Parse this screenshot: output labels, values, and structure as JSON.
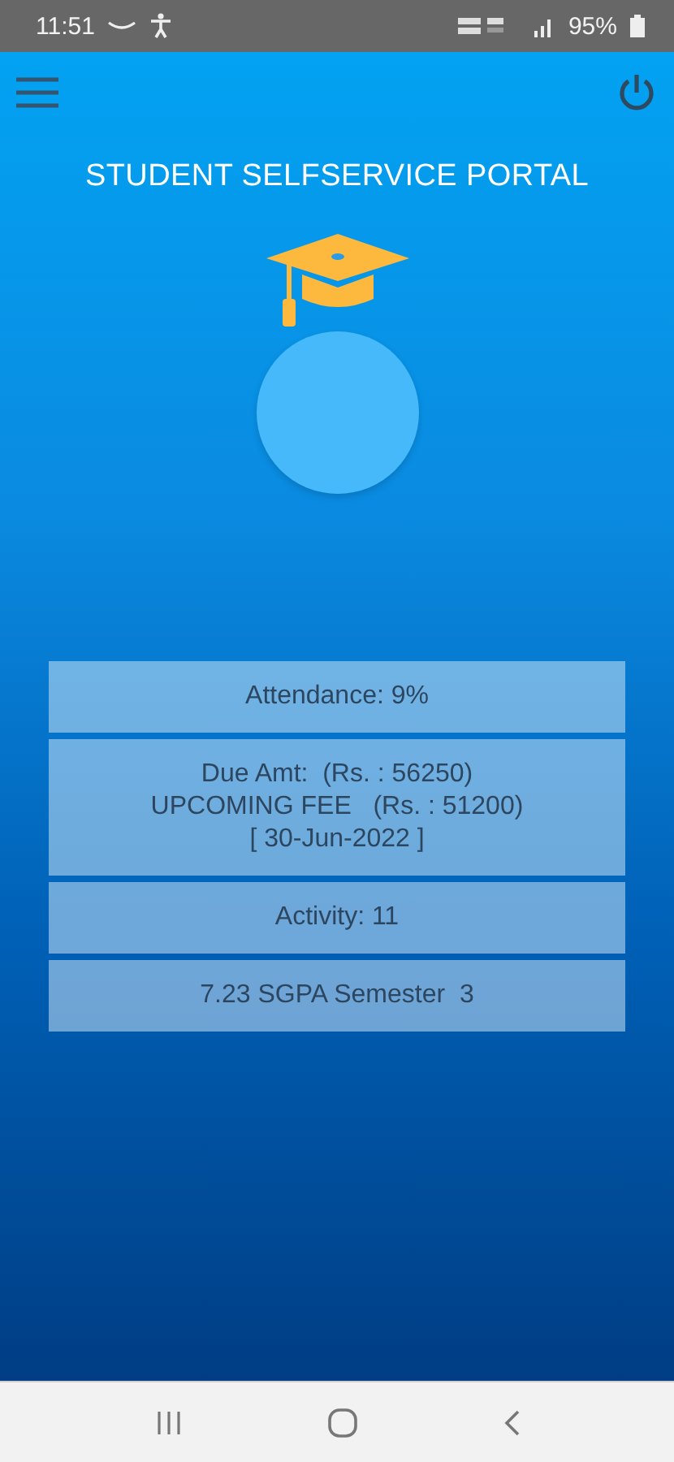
{
  "status_bar": {
    "time": "11:51",
    "battery": "95%"
  },
  "header": {
    "title": "STUDENT SELFSERVICE PORTAL"
  },
  "cards": [
    {
      "lines": [
        "Attendance: 9%"
      ]
    },
    {
      "lines": [
        "Due Amt:  (Rs. : 56250)",
        "UPCOMING FEE   (Rs. : 51200)",
        "[ 30-Jun-2022 ]"
      ]
    },
    {
      "lines": [
        "Activity: 11"
      ]
    },
    {
      "lines": [
        "7.23 SGPA Semester  3"
      ]
    }
  ]
}
